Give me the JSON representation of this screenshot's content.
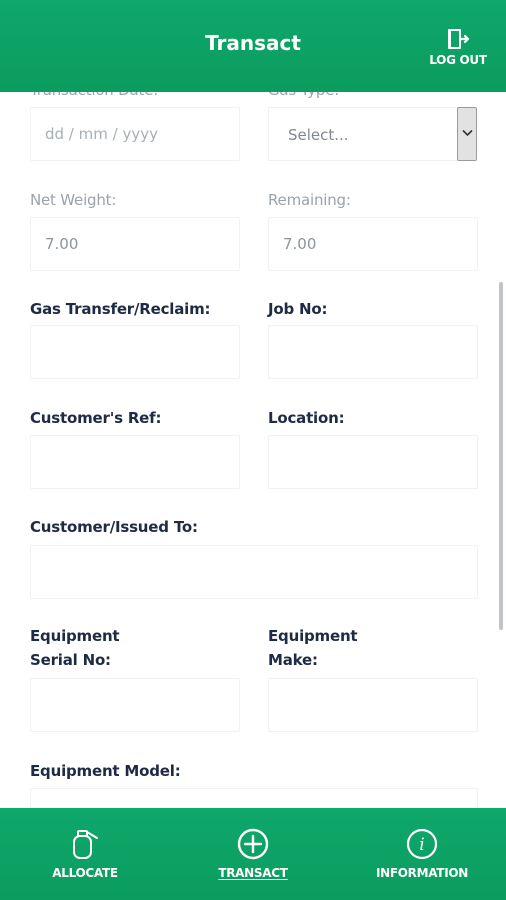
{
  "header": {
    "title": "Transact",
    "logout_label": "LOG OUT",
    "logout_icon": "logout-door-icon",
    "background": "#0ea366"
  },
  "form": {
    "transaction_date": {
      "label": "Transaction Date:",
      "placeholder": "dd / mm / yyyy"
    },
    "gas_type": {
      "label": "Gas Type:",
      "selected": "Select..."
    },
    "net_weight": {
      "label": "Net Weight:",
      "value": "7.00"
    },
    "remaining": {
      "label": "Remaining:",
      "value": "7.00"
    },
    "gas_transfer": {
      "label": "Gas Transfer/Reclaim:",
      "value": ""
    },
    "job_no": {
      "label": "Job No:",
      "value": ""
    },
    "customer_ref": {
      "label": "Customer's Ref:",
      "value": ""
    },
    "location": {
      "label": "Location:",
      "value": ""
    },
    "customer_issued": {
      "label": "Customer/Issued To:",
      "value": ""
    },
    "equipment_serial": {
      "label_line1": "Equipment",
      "label_line2": "Serial No:",
      "value": ""
    },
    "equipment_make": {
      "label_line1": "Equipment",
      "label_line2": "Make:",
      "value": ""
    },
    "equipment_model": {
      "label": "Equipment Model:",
      "value": ""
    }
  },
  "bottom_nav": {
    "items": [
      {
        "label": "ALLOCATE",
        "icon": "gas-cylinder-icon",
        "active": false
      },
      {
        "label": "TRANSACT",
        "icon": "plus-circle-icon",
        "active": true
      },
      {
        "label": "INFORMATION",
        "icon": "info-circle-icon",
        "active": false
      }
    ]
  }
}
